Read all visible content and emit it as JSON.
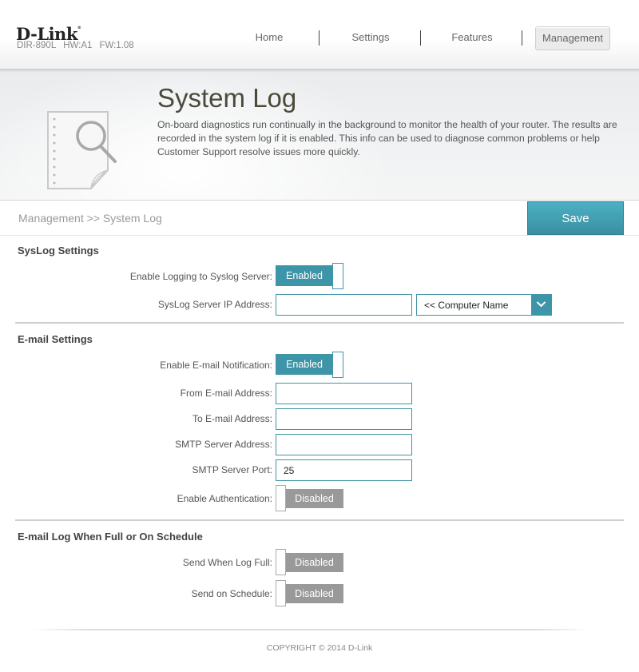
{
  "header": {
    "brand": "D-Link",
    "model": "DIR-890L",
    "hw": "HW:A1",
    "fw": "FW:1.08",
    "nav": [
      {
        "label": "Home",
        "active": false
      },
      {
        "label": "Settings",
        "active": false
      },
      {
        "label": "Features",
        "active": false
      },
      {
        "label": "Management",
        "active": true
      }
    ]
  },
  "hero": {
    "icon": "document-search-icon",
    "title": "System Log",
    "description": "On-board diagnostics run continually in the background to monitor the health of your router. The results are recorded in the system log if it is enabled. This info can be used to diagnose common problems or help Customer Support resolve issues more quickly."
  },
  "breadcrumb": "Management >> System Log",
  "save_label": "Save",
  "colors": {
    "accent": "#3e95a7",
    "disabled": "#999999"
  },
  "sections": {
    "syslog": {
      "title": "SysLog Settings",
      "enable_label": "Enable Logging to Syslog Server:",
      "enable_state": "Enabled",
      "ip_label": "SysLog Server IP Address:",
      "ip_value": "",
      "computer_select": "<< Computer Name"
    },
    "email": {
      "title": "E-mail Settings",
      "notify_label": "Enable E-mail Notification:",
      "notify_state": "Enabled",
      "from_label": "From E-mail Address:",
      "from_value": "",
      "to_label": "To E-mail Address:",
      "to_value": "",
      "smtp_addr_label": "SMTP Server Address:",
      "smtp_addr_value": "",
      "smtp_port_label": "SMTP Server Port:",
      "smtp_port_value": "25",
      "auth_label": "Enable Authentication:",
      "auth_state": "Disabled"
    },
    "schedule": {
      "title": "E-mail Log When Full or On Schedule",
      "full_label": "Send When Log Full:",
      "full_state": "Disabled",
      "schedule_label": "Send on Schedule:",
      "schedule_state": "Disabled"
    }
  },
  "footer": {
    "copyright": "COPYRIGHT © 2014 D-Link"
  }
}
